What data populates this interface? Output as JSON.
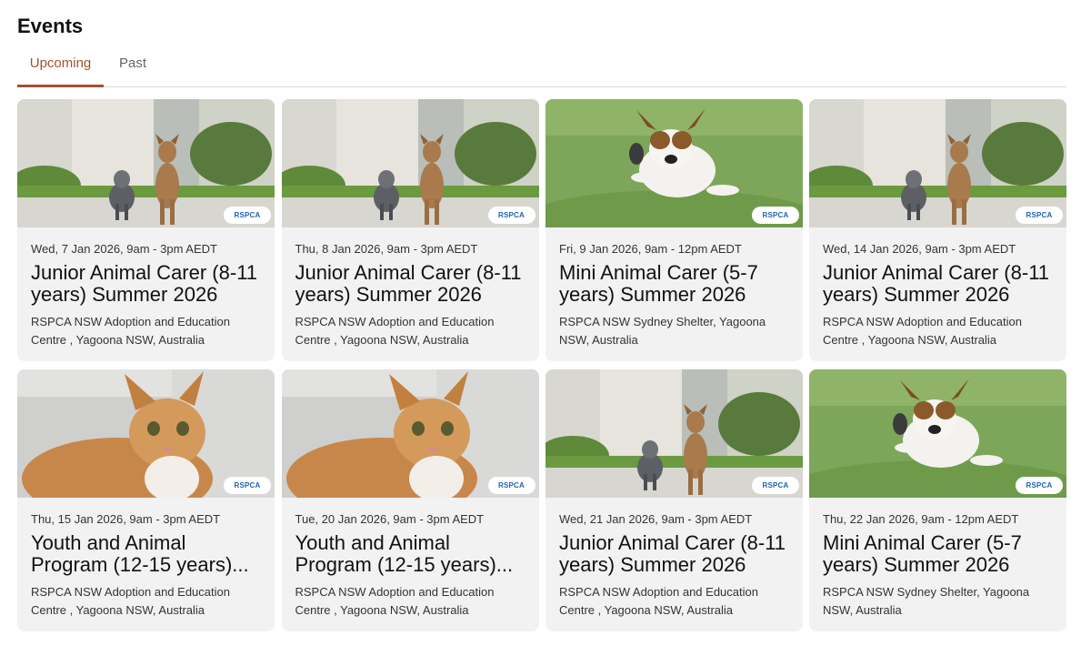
{
  "page_title": "Events",
  "tabs": [
    {
      "label": "Upcoming",
      "active": true
    },
    {
      "label": "Past",
      "active": false
    }
  ],
  "brand": {
    "accent": "#a0522d",
    "logo_text": "RSPCA"
  },
  "events": [
    {
      "image": "dogs-pair-photo",
      "date": "Wed, 7 Jan 2026, 9am - 3pm AEDT",
      "title": "Junior Animal Carer (8-11 years) Summer 2026",
      "location": "RSPCA NSW Adoption and Education Centre , Yagoona NSW, Australia"
    },
    {
      "image": "dogs-pair-photo",
      "date": "Thu, 8 Jan 2026, 9am - 3pm AEDT",
      "title": "Junior Animal Carer (8-11 years) Summer 2026",
      "location": "RSPCA NSW Adoption and Education Centre , Yagoona NSW, Australia"
    },
    {
      "image": "running-puppy-photo",
      "date": "Fri, 9 Jan 2026, 9am - 12pm AEDT",
      "title": "Mini Animal Carer (5-7 years) Summer 2026",
      "location": "RSPCA NSW Sydney Shelter, Yagoona NSW, Australia"
    },
    {
      "image": "dogs-pair-photo",
      "date": "Wed, 14 Jan 2026, 9am - 3pm AEDT",
      "title": "Junior Animal Carer (8-11 years) Summer 2026",
      "location": "RSPCA NSW Adoption and Education Centre , Yagoona NSW, Australia"
    },
    {
      "image": "ginger-cat-photo",
      "date": "Thu, 15 Jan 2026, 9am - 3pm AEDT",
      "title": "Youth and Animal Program (12-15 years)...",
      "location": "RSPCA NSW Adoption and Education Centre , Yagoona NSW, Australia"
    },
    {
      "image": "ginger-cat-photo",
      "date": "Tue, 20 Jan 2026, 9am - 3pm AEDT",
      "title": "Youth and Animal Program (12-15 years)...",
      "location": "RSPCA NSW Adoption and Education Centre , Yagoona NSW, Australia"
    },
    {
      "image": "dogs-pair-photo",
      "date": "Wed, 21 Jan 2026, 9am - 3pm AEDT",
      "title": "Junior Animal Carer (8-11 years) Summer 2026",
      "location": "RSPCA NSW Adoption and Education Centre , Yagoona NSW, Australia"
    },
    {
      "image": "running-puppy-photo",
      "date": "Thu, 22 Jan 2026, 9am - 12pm AEDT",
      "title": "Mini Animal Carer (5-7 years) Summer 2026",
      "location": "RSPCA NSW Sydney Shelter, Yagoona NSW, Australia"
    }
  ]
}
